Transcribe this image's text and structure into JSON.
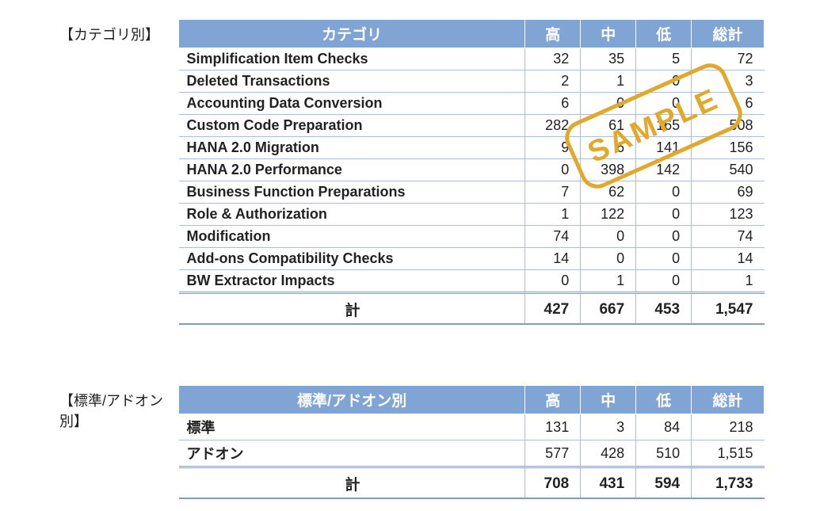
{
  "section1": {
    "label": "【カテゴリ別】",
    "headers": [
      "カテゴリ",
      "高",
      "中",
      "低",
      "総計"
    ],
    "rows": [
      {
        "cat": "Simplification Item Checks",
        "h": "32",
        "m": "35",
        "l": "5",
        "t": "72"
      },
      {
        "cat": "Deleted Transactions",
        "h": "2",
        "m": "1",
        "l": "0",
        "t": "3"
      },
      {
        "cat": "Accounting Data Conversion",
        "h": "6",
        "m": "0",
        "l": "0",
        "t": "6"
      },
      {
        "cat": "Custom Code Preparation",
        "h": "282",
        "m": "61",
        "l": "165",
        "t": "508"
      },
      {
        "cat": "HANA 2.0 Migration",
        "h": "9",
        "m": "6",
        "l": "141",
        "t": "156"
      },
      {
        "cat": "HANA 2.0 Performance",
        "h": "0",
        "m": "398",
        "l": "142",
        "t": "540"
      },
      {
        "cat": "Business Function Preparations",
        "h": "7",
        "m": "62",
        "l": "0",
        "t": "69"
      },
      {
        "cat": "Role & Authorization",
        "h": "1",
        "m": "122",
        "l": "0",
        "t": "123"
      },
      {
        "cat": "Modification",
        "h": "74",
        "m": "0",
        "l": "0",
        "t": "74"
      },
      {
        "cat": "Add-ons Compatibility Checks",
        "h": "14",
        "m": "0",
        "l": "0",
        "t": "14"
      },
      {
        "cat": "BW Extractor Impacts",
        "h": "0",
        "m": "1",
        "l": "0",
        "t": "1"
      }
    ],
    "footer": {
      "label": "計",
      "h": "427",
      "m": "667",
      "l": "453",
      "t": "1,547"
    }
  },
  "section2": {
    "label": "【標準/アドオン別】",
    "headers": [
      "標準/アドオン別",
      "高",
      "中",
      "低",
      "総計"
    ],
    "rows": [
      {
        "cat": "標準",
        "h": "131",
        "m": "3",
        "l": "84",
        "t": "218"
      },
      {
        "cat": "アドオン",
        "h": "577",
        "m": "428",
        "l": "510",
        "t": "1,515"
      }
    ],
    "footer": {
      "label": "計",
      "h": "708",
      "m": "431",
      "l": "594",
      "t": "1,733"
    }
  },
  "stamp": "SAMPLE"
}
